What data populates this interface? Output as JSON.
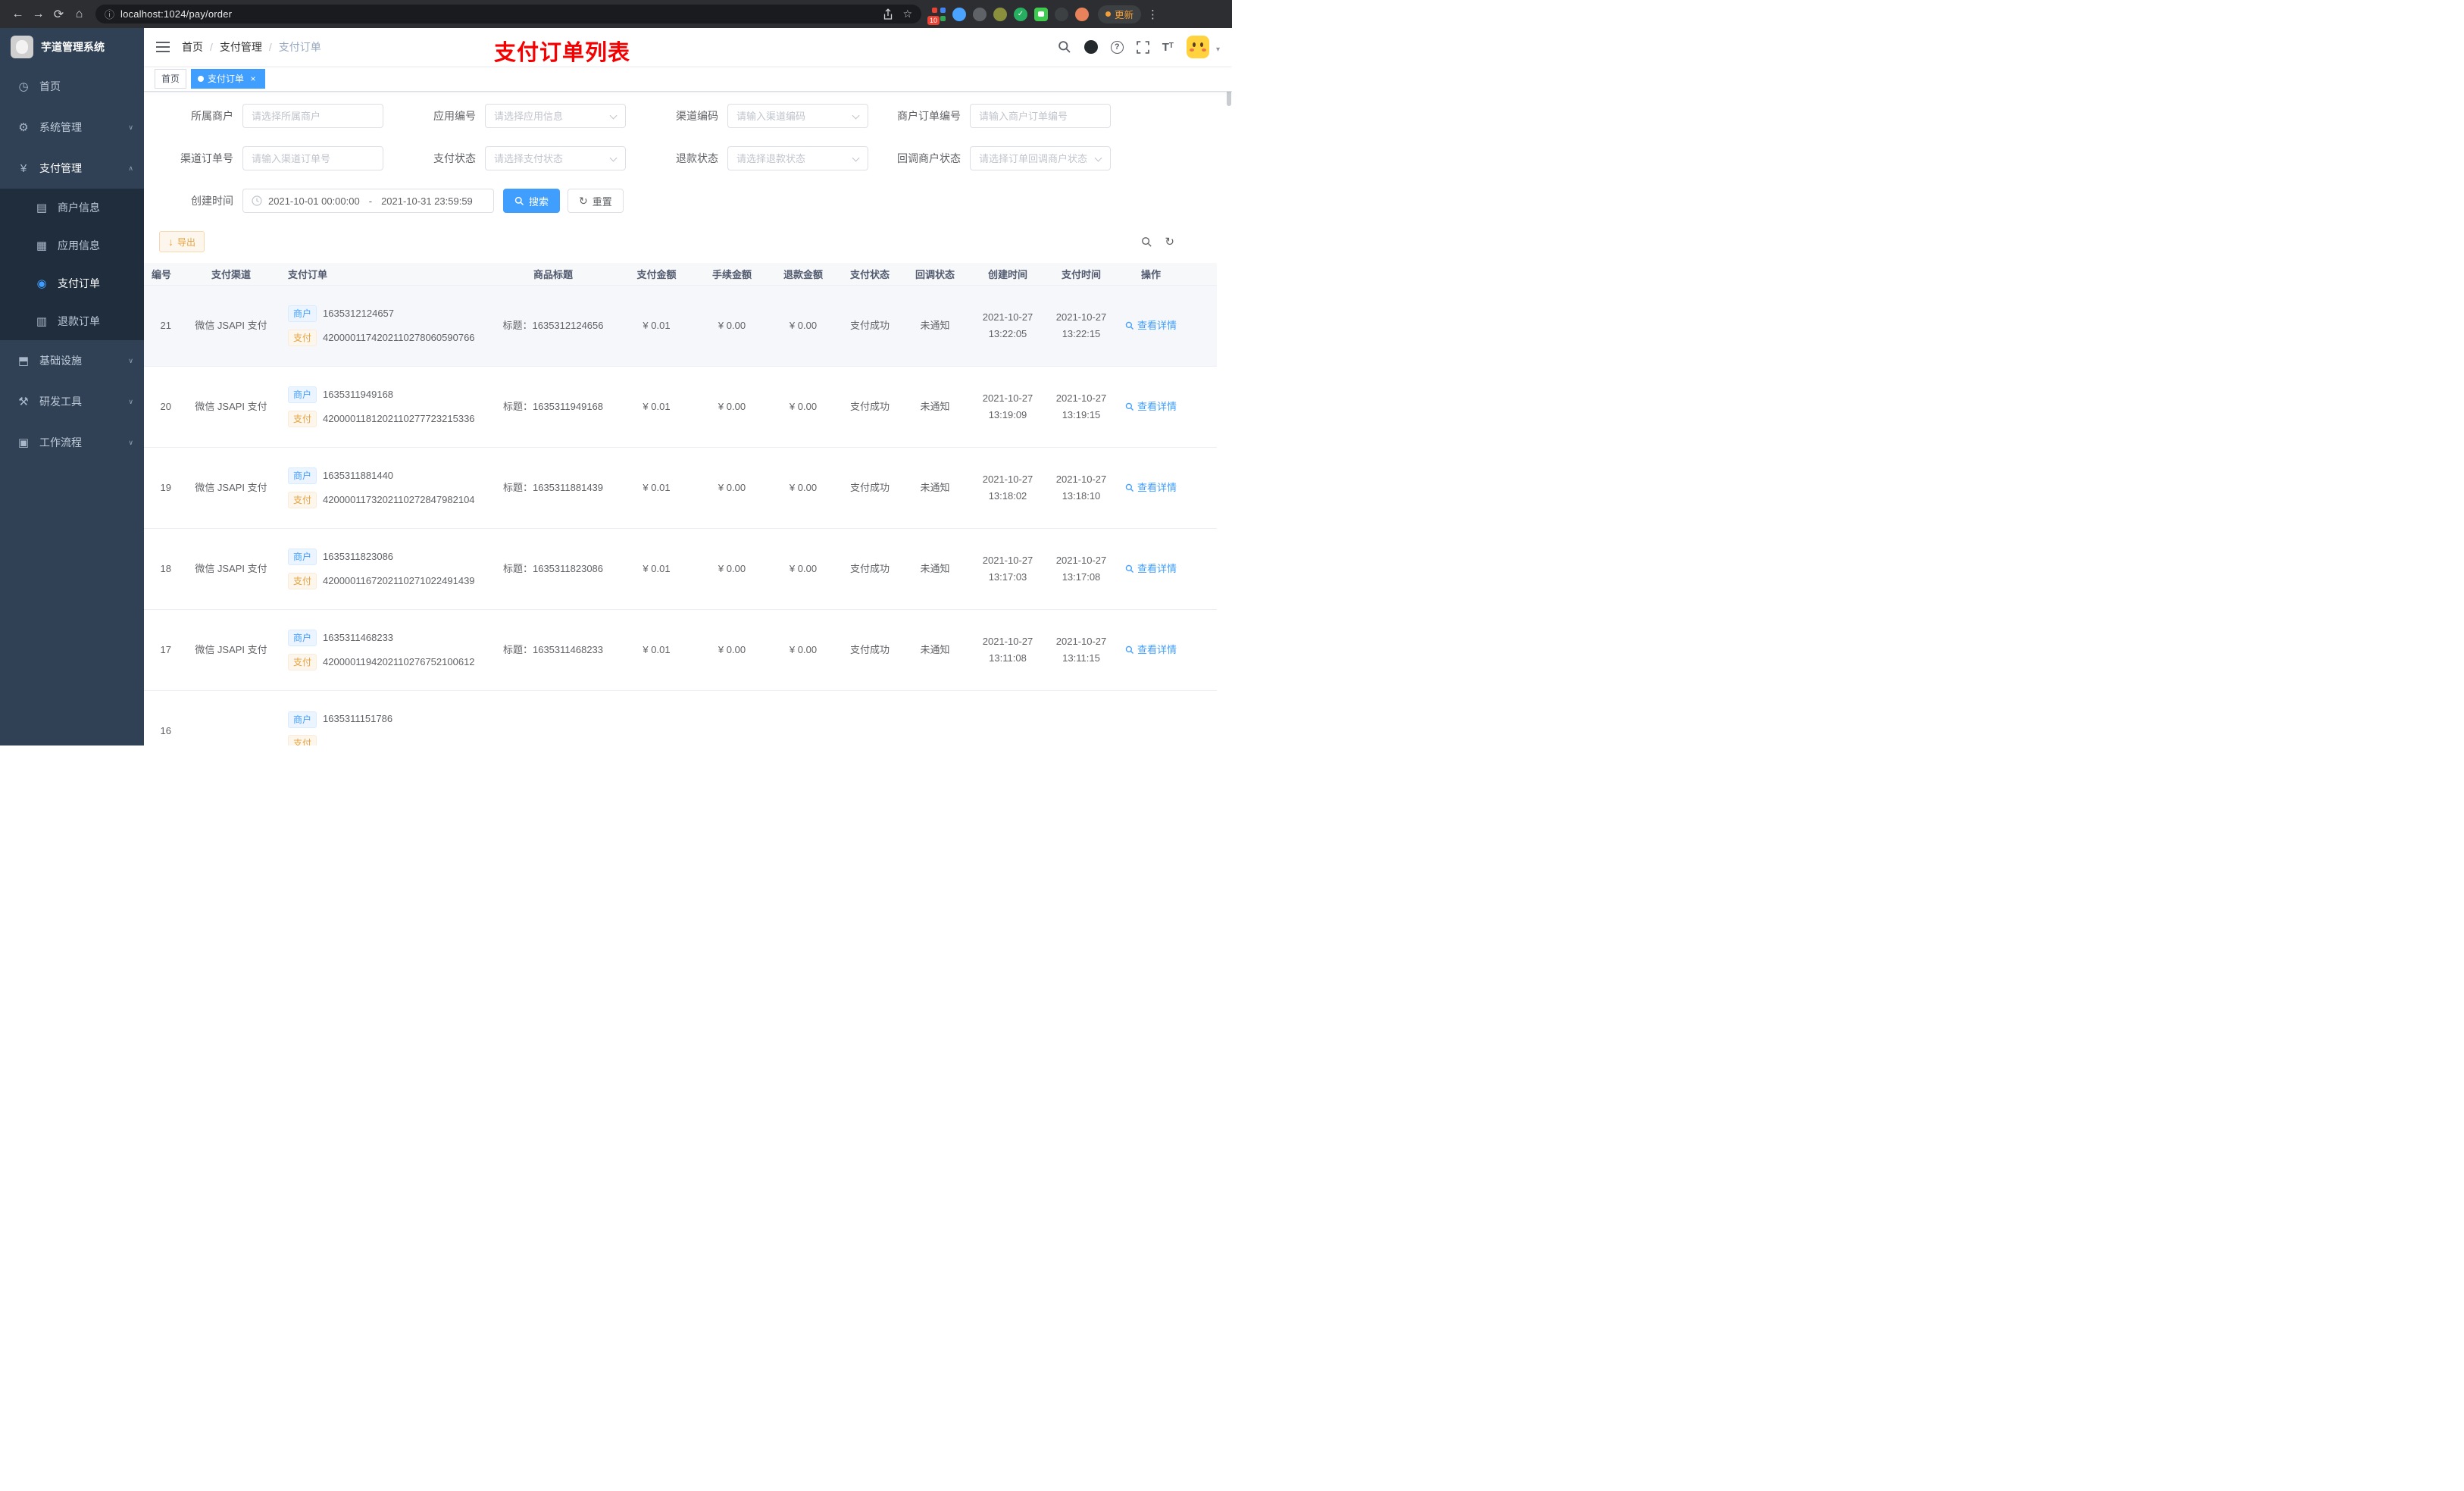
{
  "browser": {
    "url": "localhost:1024/pay/order",
    "update_label": "更新",
    "extension_badge": "10"
  },
  "icons": {
    "back": "←",
    "forward": "→",
    "reload": "⟳",
    "home": "⌂",
    "info": "ⓘ",
    "star": "☆",
    "menu_dots": "⋮",
    "check": "✓",
    "dashboard": "◷",
    "gear": "⚙",
    "yen": "¥",
    "card": "▤",
    "grid": "▦",
    "target": "◉",
    "doc": "▥",
    "infra": "⬒",
    "tools": "⚒",
    "workflow": "▣",
    "chevron_down": "∨",
    "chevron_up": "∧",
    "question": "?",
    "font_size": "T",
    "caret": "▾",
    "download": "↓",
    "refresh": "↻",
    "close": "×",
    "slash": "/"
  },
  "sidebar": {
    "title": "芋道管理系统",
    "items": [
      {
        "label": "首页"
      },
      {
        "label": "系统管理"
      },
      {
        "label": "支付管理"
      },
      {
        "label": "基础设施"
      },
      {
        "label": "研发工具"
      },
      {
        "label": "工作流程"
      }
    ],
    "submenu": [
      {
        "label": "商户信息"
      },
      {
        "label": "应用信息"
      },
      {
        "label": "支付订单"
      },
      {
        "label": "退款订单"
      }
    ]
  },
  "navbar": {
    "breadcrumb": [
      "首页",
      "支付管理",
      "支付订单"
    ],
    "annotation": "支付订单列表"
  },
  "tabs": [
    {
      "label": "首页"
    },
    {
      "label": "支付订单"
    }
  ],
  "filter": {
    "fields": [
      {
        "label": "所属商户",
        "placeholder": "请选择所属商户"
      },
      {
        "label": "应用编号",
        "placeholder": "请选择应用信息"
      },
      {
        "label": "渠道编码",
        "placeholder": "请输入渠道编码"
      },
      {
        "label": "商户订单编号",
        "placeholder": "请输入商户订单编号"
      },
      {
        "label": "渠道订单号",
        "placeholder": "请输入渠道订单号"
      },
      {
        "label": "支付状态",
        "placeholder": "请选择支付状态"
      },
      {
        "label": "退款状态",
        "placeholder": "请选择退款状态"
      },
      {
        "label": "回调商户状态",
        "placeholder": "请选择订单回调商户状态"
      }
    ],
    "date_label": "创建时间",
    "date_start": "2021-10-01 00:00:00",
    "date_separator": "-",
    "date_end": "2021-10-31 23:59:59",
    "search_label": "搜索",
    "reset_label": "重置"
  },
  "toolbar": {
    "export_label": "导出"
  },
  "table": {
    "columns": [
      "编号",
      "支付渠道",
      "支付订单",
      "商品标题",
      "支付金额",
      "手续金额",
      "退款金额",
      "支付状态",
      "回调状态",
      "创建时间",
      "支付时间",
      "操作"
    ],
    "merchant_tag": "商户",
    "pay_tag": "支付",
    "action_label": "查看详情",
    "rows": [
      {
        "id": "21",
        "channel": "微信 JSAPI 支付",
        "merchant_no": "1635312124657",
        "pay_no": "4200001174202110278060590766",
        "title": "标题：1635312124656",
        "amount": "¥ 0.01",
        "fee": "¥ 0.00",
        "refund": "¥ 0.00",
        "status": "支付成功",
        "notify": "未通知",
        "create_time": "2021-10-27 13:22:05",
        "pay_time": "2021-10-27 13:22:15"
      },
      {
        "id": "20",
        "channel": "微信 JSAPI 支付",
        "merchant_no": "1635311949168",
        "pay_no": "4200001181202110277723215336",
        "title": "标题：1635311949168",
        "amount": "¥ 0.01",
        "fee": "¥ 0.00",
        "refund": "¥ 0.00",
        "status": "支付成功",
        "notify": "未通知",
        "create_time": "2021-10-27 13:19:09",
        "pay_time": "2021-10-27 13:19:15"
      },
      {
        "id": "19",
        "channel": "微信 JSAPI 支付",
        "merchant_no": "1635311881440",
        "pay_no": "4200001173202110272847982104",
        "title": "标题：1635311881439",
        "amount": "¥ 0.01",
        "fee": "¥ 0.00",
        "refund": "¥ 0.00",
        "status": "支付成功",
        "notify": "未通知",
        "create_time": "2021-10-27 13:18:02",
        "pay_time": "2021-10-27 13:18:10"
      },
      {
        "id": "18",
        "channel": "微信 JSAPI 支付",
        "merchant_no": "1635311823086",
        "pay_no": "4200001167202110271022491439",
        "title": "标题：1635311823086",
        "amount": "¥ 0.01",
        "fee": "¥ 0.00",
        "refund": "¥ 0.00",
        "status": "支付成功",
        "notify": "未通知",
        "create_time": "2021-10-27 13:17:03",
        "pay_time": "2021-10-27 13:17:08"
      },
      {
        "id": "17",
        "channel": "微信 JSAPI 支付",
        "merchant_no": "1635311468233",
        "pay_no": "4200001194202110276752100612",
        "title": "标题：1635311468233",
        "amount": "¥ 0.01",
        "fee": "¥ 0.00",
        "refund": "¥ 0.00",
        "status": "支付成功",
        "notify": "未通知",
        "create_time": "2021-10-27 13:11:08",
        "pay_time": "2021-10-27 13:11:15"
      },
      {
        "id": "16",
        "merchant_no": "1635311151786"
      }
    ]
  }
}
